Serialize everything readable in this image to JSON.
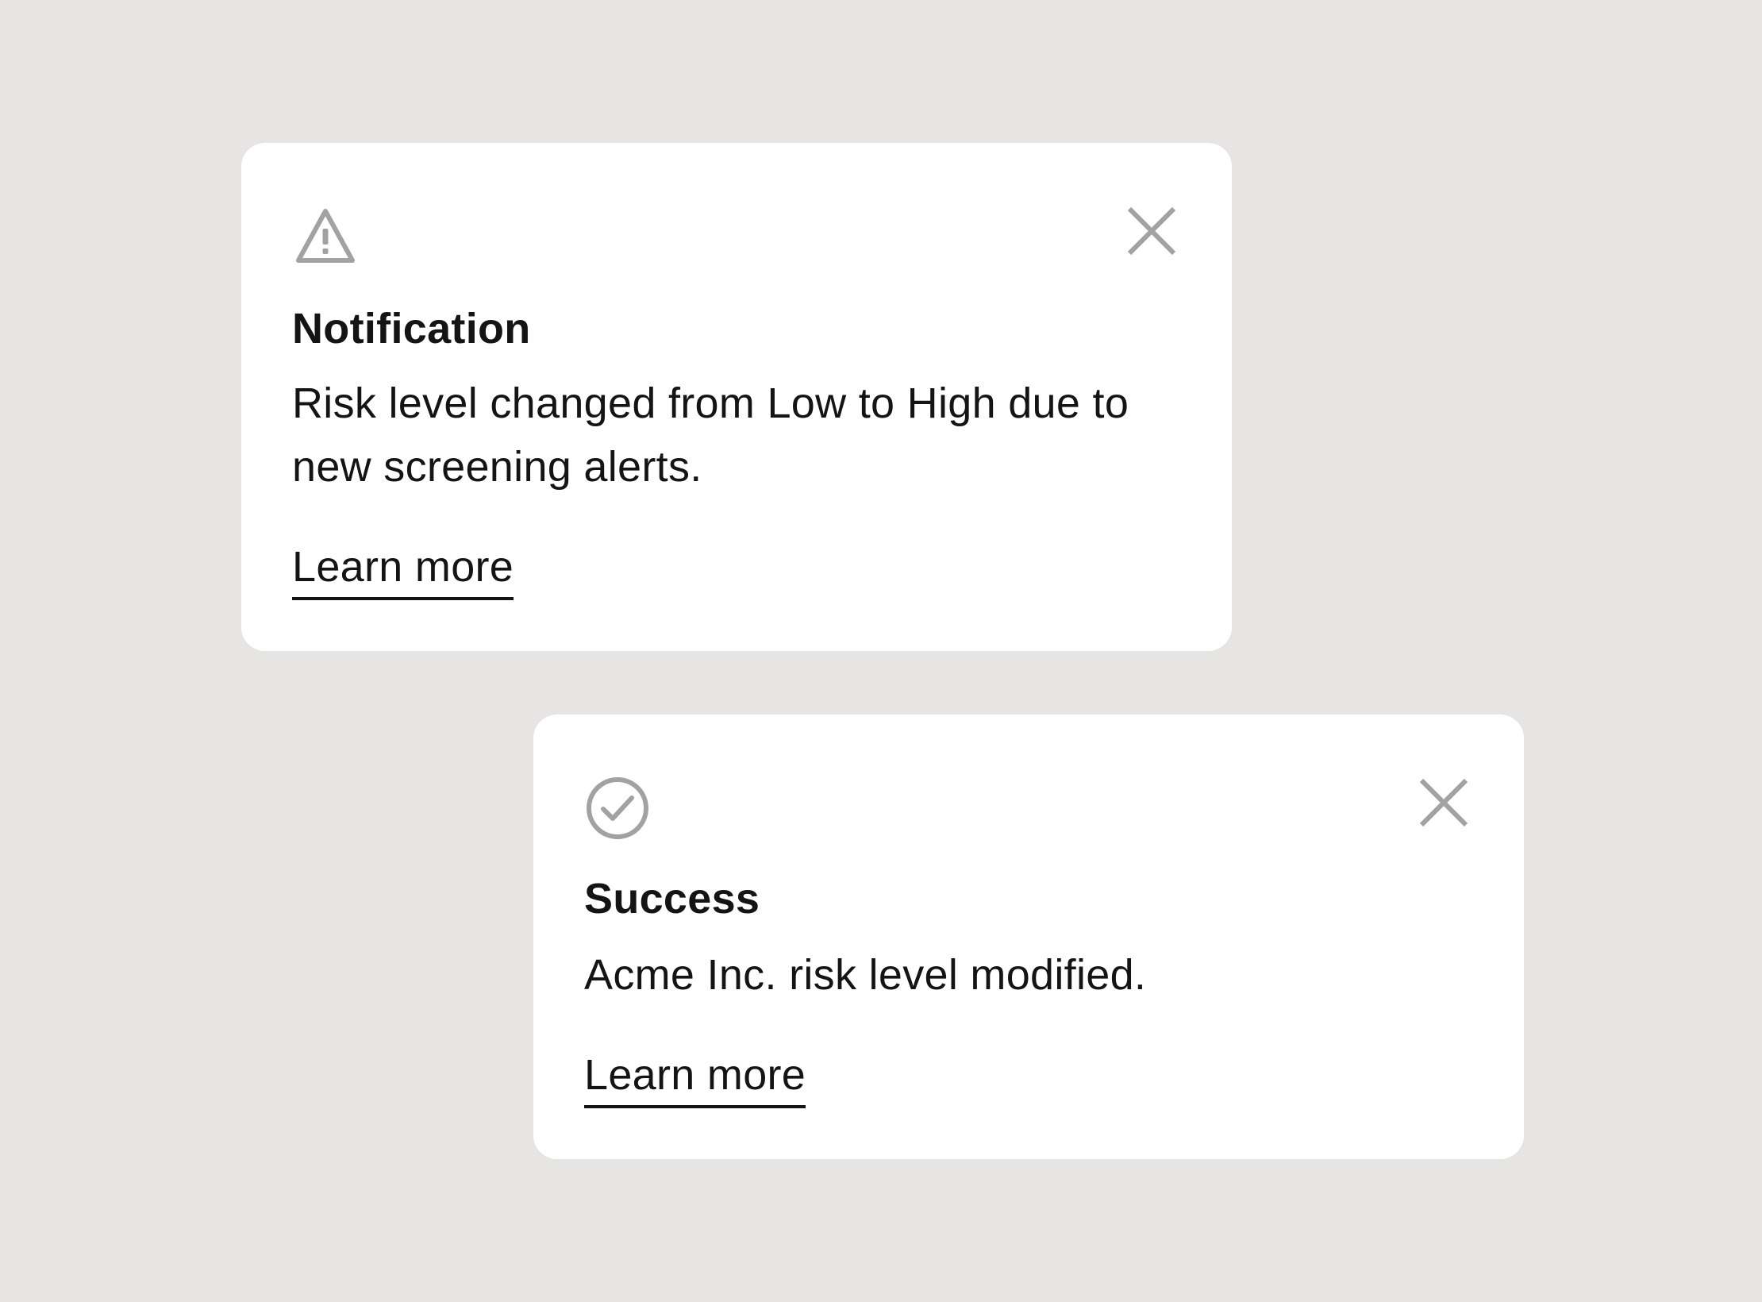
{
  "colors": {
    "background": "#e6e5e3",
    "card": "#ffffff",
    "text": "#141414",
    "icon": "#a3a2a0"
  },
  "toasts": [
    {
      "type": "warning",
      "icon": "warning-triangle-icon",
      "title": "Notification",
      "message": "Risk level changed from Low to High due to new screening alerts.",
      "link_label": "Learn more",
      "close_icon": "close-icon"
    },
    {
      "type": "success",
      "icon": "check-circle-icon",
      "title": "Success",
      "message": "Acme Inc. risk level modified.",
      "link_label": "Learn more",
      "close_icon": "close-icon"
    }
  ]
}
